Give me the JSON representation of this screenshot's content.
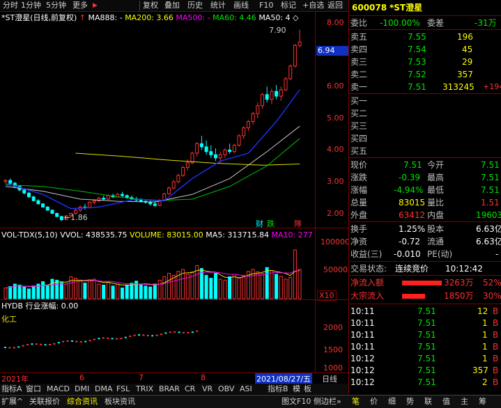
{
  "toolbar": {
    "items": [
      "分时",
      "1分钟",
      "5分钟",
      "更多",
      "复权",
      "叠加",
      "历史",
      "统计",
      "画线",
      "F10",
      "标记",
      "+自选",
      "返回"
    ],
    "more_arrow": "▶"
  },
  "main_chart": {
    "title": "*ST澄星(日线,前复权)",
    "arrow": "↑",
    "ma_label": "MA888: -",
    "ma200": "MA200: 3.66",
    "ma500": "MA500: -",
    "ma60": "MA60: 4.46",
    "ma50": "MA50: 4",
    "diamond": "◇",
    "high_label": "7.90",
    "low_label": "1.86",
    "current_tag": "6.94",
    "y_ticks": [
      "8.00",
      "7.00",
      "6.00",
      "5.00",
      "4.00",
      "3.00",
      "2.00"
    ],
    "markers": {
      "cai": "财",
      "die": "跌",
      "ka": "隊"
    }
  },
  "volume_panel": {
    "title": "VOL-TDX(5,10)",
    "vvol": "VVOL: 438535.75",
    "volume": "VOLUME: 83015.00",
    "ma5": "MA5: 313715.84",
    "ma10": "MA10: 277",
    "y_ticks": [
      "100000",
      "50000"
    ],
    "unit": "X10"
  },
  "hydb_panel": {
    "title": "HYDB 行业涨幅: 0.00",
    "industry": "化工",
    "y_ticks": [
      "2000",
      "1500",
      "1000"
    ]
  },
  "date_axis": {
    "labels": [
      "2021年",
      "6",
      "7",
      "8"
    ],
    "current_date": "2021/08/27/五"
  },
  "tabbar": {
    "items": [
      "指标A",
      "窗口",
      "MACD",
      "DMI",
      "DMA",
      "FSL",
      "TRIX",
      "BRAR",
      "CR",
      "VR",
      "OBV",
      "ASI"
    ],
    "right_items": [
      "指标B",
      "模",
      "板"
    ],
    "period": "日线"
  },
  "bottombar": {
    "items": [
      "扩展^",
      "关联报价",
      "综合资讯",
      "板块资讯"
    ],
    "right_items": [
      "图文F10",
      "侧边栏»"
    ],
    "panel_tabs": [
      "笔",
      "价",
      "细",
      "势",
      "联",
      "值",
      "主",
      "筹"
    ]
  },
  "quote": {
    "code": "600078",
    "name": "*ST澄星",
    "weibi_label": "委比",
    "weibi_value": "-100.00%",
    "weicha_label": "委差",
    "weicha_value": "-31万",
    "asks": [
      {
        "label": "卖五",
        "price": "7.55",
        "vol": "196",
        "chg": ""
      },
      {
        "label": "卖四",
        "price": "7.54",
        "vol": "45",
        "chg": ""
      },
      {
        "label": "卖三",
        "price": "7.53",
        "vol": "29",
        "chg": ""
      },
      {
        "label": "卖二",
        "price": "7.52",
        "vol": "357",
        "chg": ""
      },
      {
        "label": "卖一",
        "price": "7.51",
        "vol": "313245",
        "chg": "+194"
      }
    ],
    "bids": [
      "买一",
      "买二",
      "买三",
      "买四",
      "买五"
    ],
    "stats": [
      {
        "l1": "现价",
        "v1": "7.51",
        "l2": "今开",
        "v2": "7.51"
      },
      {
        "l1": "涨跌",
        "v1": "-0.39",
        "l2": "最高",
        "v2": "7.51"
      },
      {
        "l1": "涨幅",
        "v1": "-4.94%",
        "l2": "最低",
        "v2": "7.51"
      },
      {
        "l1": "总量",
        "v1": "83015",
        "l2": "量比",
        "v2": "1.51"
      },
      {
        "l1": "外盘",
        "v1": "63412",
        "l2": "内盘",
        "v2": "19603"
      }
    ],
    "stats2": [
      {
        "l1": "换手",
        "v1": "1.25%",
        "l2": "股本",
        "v2": "6.63亿"
      },
      {
        "l1": "净资",
        "v1": "-0.72",
        "l2": "流通",
        "v2": "6.63亿"
      },
      {
        "l1": "收益(三)",
        "v1": "-0.010",
        "l2": "PE(动)",
        "v2": "-"
      }
    ],
    "trade_status_label": "交易状态:",
    "trade_status": "连续竞价",
    "trade_time": "10:12:42",
    "flows": [
      {
        "label": "净流入额",
        "value": "3263万",
        "pct": "52%",
        "bar": 0.52
      },
      {
        "label": "大宗流入",
        "value": "1850万",
        "pct": "30%",
        "bar": 0.3
      }
    ],
    "ticks": [
      {
        "time": "10:11",
        "price": "7.51",
        "vol": "12",
        "side": "B"
      },
      {
        "time": "10:11",
        "price": "7.51",
        "vol": "1",
        "side": "B"
      },
      {
        "time": "10:11",
        "price": "7.51",
        "vol": "1",
        "side": "B"
      },
      {
        "time": "10:11",
        "price": "7.51",
        "vol": "1",
        "side": "B"
      },
      {
        "time": "10:12",
        "price": "7.51",
        "vol": "1",
        "side": "B"
      },
      {
        "time": "10:12",
        "price": "7.51",
        "vol": "357",
        "side": "B"
      },
      {
        "time": "10:12",
        "price": "7.51",
        "vol": "2",
        "side": "B"
      }
    ]
  },
  "colors": {
    "up": "#ff3232",
    "down": "#00ffff",
    "ma_yellow": "#e0e000",
    "ma_green": "#00c000",
    "ma_blue": "#2040ff",
    "ma_white": "#d0d0d0"
  }
}
